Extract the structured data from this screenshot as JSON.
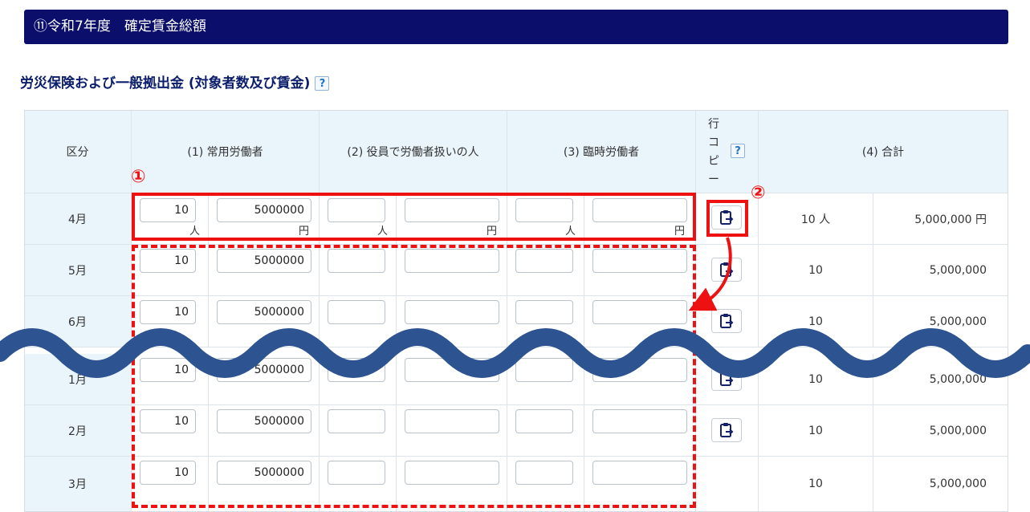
{
  "section_title": "⑪令和7年度　確定賃金総額",
  "subtitle": "労災保険および一般拠出金 (対象者数及び賃金)",
  "help_icon": "?",
  "headers": {
    "kubun": "区分",
    "regular": "(1) 常用労働者",
    "officer": "(2) 役員で労働者扱いの人",
    "temp": "(3) 臨時労働者",
    "row_copy": [
      "行",
      "コ",
      "ピ",
      "ー"
    ],
    "total": "(4) 合計"
  },
  "units": {
    "person": "人",
    "yen": "円"
  },
  "rows": [
    {
      "month": "4月",
      "workers": "10",
      "wage": "5000000",
      "total_workers": "10 人",
      "total_wage": "5,000,000 円"
    },
    {
      "month": "5月",
      "workers": "10",
      "wage": "5000000",
      "total_workers": "10",
      "total_wage": "5,000,000"
    },
    {
      "month": "6月",
      "workers": "10",
      "wage": "5000000",
      "total_workers": "10",
      "total_wage": "5,000,000"
    },
    {
      "month": "1月",
      "workers": "10",
      "wage": "5000000",
      "total_workers": "10",
      "total_wage": "5,000,000"
    },
    {
      "month": "2月",
      "workers": "10",
      "wage": "5000000",
      "total_workers": "10",
      "total_wage": "5,000,000"
    },
    {
      "month": "3月",
      "workers": "10",
      "wage": "5000000",
      "total_workers": "10",
      "total_wage": "5,000,000"
    }
  ],
  "annotations": {
    "one": "①",
    "two": "②"
  },
  "colors": {
    "section_bg": "#0b0f6b",
    "header_bg": "#eaf4fb",
    "annotation_red": "#ee1111",
    "wave": "#2d5391"
  }
}
